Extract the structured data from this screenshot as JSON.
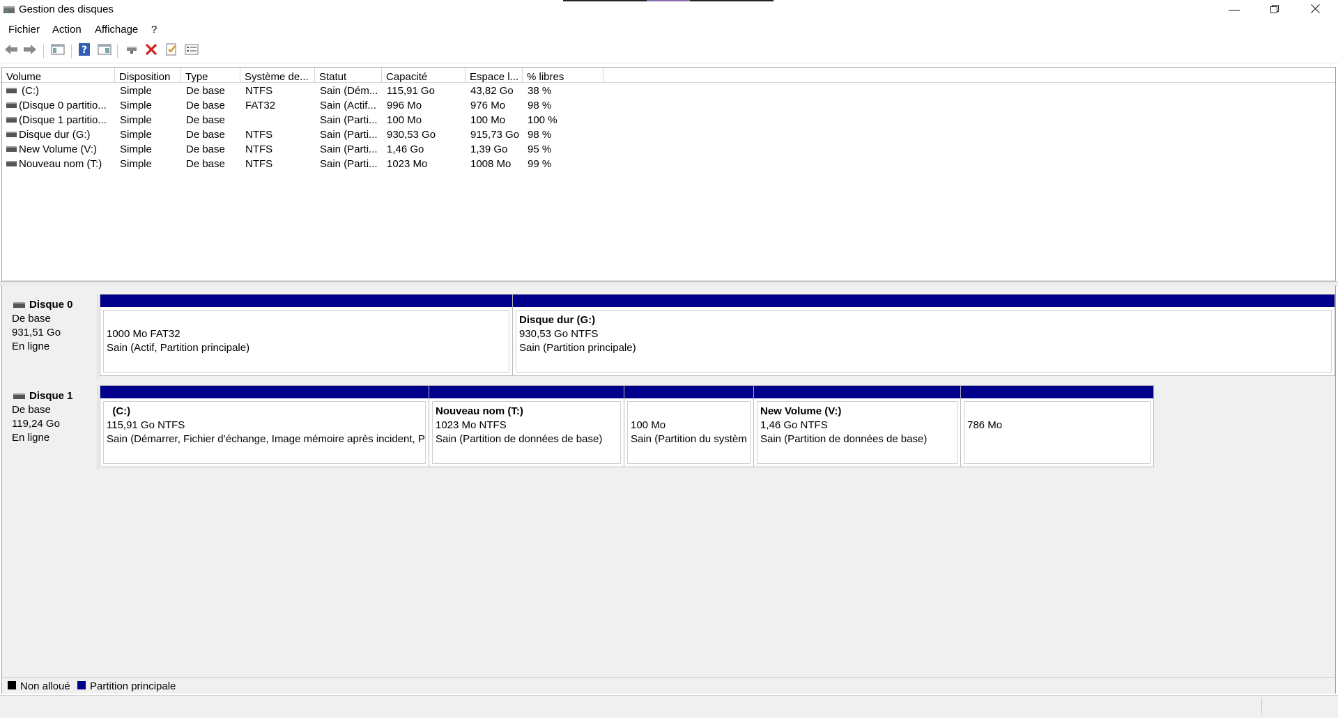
{
  "window": {
    "title": "Gestion des disques",
    "app_icon": "disk-management-icon",
    "controls": [
      "minimize-icon",
      "restore-icon",
      "close-icon"
    ]
  },
  "menu": {
    "items": [
      "Fichier",
      "Action",
      "Affichage",
      "?"
    ]
  },
  "toolbar": {
    "buttons": [
      "back-arrow-icon",
      "forward-arrow-icon",
      "console-tree-icon",
      "help-icon",
      "properties-panel-icon",
      "connect-icon",
      "delete-icon",
      "checklist-icon",
      "settings-list-icon"
    ]
  },
  "volume_list": {
    "columns": [
      "Volume",
      "Disposition",
      "Type",
      "Système de...",
      "Statut",
      "Capacité",
      "Espace l...",
      "% libres"
    ],
    "rows": [
      {
        "volume": "(C:)",
        "disposition": "Simple",
        "type": "De base",
        "fs": "NTFS",
        "status": "Sain (Dém...",
        "capacity": "115,91 Go",
        "free": "43,82 Go",
        "pct": "38 %"
      },
      {
        "volume": "(Disque 0 partitio...",
        "disposition": "Simple",
        "type": "De base",
        "fs": "FAT32",
        "status": "Sain (Actif...",
        "capacity": "996 Mo",
        "free": "976 Mo",
        "pct": "98 %"
      },
      {
        "volume": "(Disque 1 partitio...",
        "disposition": "Simple",
        "type": "De base",
        "fs": "",
        "status": "Sain (Parti...",
        "capacity": "100 Mo",
        "free": "100 Mo",
        "pct": "100 %"
      },
      {
        "volume": "Disque dur (G:)",
        "disposition": "Simple",
        "type": "De base",
        "fs": "NTFS",
        "status": "Sain (Parti...",
        "capacity": "930,53 Go",
        "free": "915,73 Go",
        "pct": "98 %"
      },
      {
        "volume": "New Volume (V:)",
        "disposition": "Simple",
        "type": "De base",
        "fs": "NTFS",
        "status": "Sain (Parti...",
        "capacity": "1,46 Go",
        "free": "1,39 Go",
        "pct": "95 %"
      },
      {
        "volume": "Nouveau nom (T:)",
        "disposition": "Simple",
        "type": "De base",
        "fs": "NTFS",
        "status": "Sain (Parti...",
        "capacity": "1023 Mo",
        "free": "1008 Mo",
        "pct": "99 %"
      }
    ]
  },
  "disks": [
    {
      "name": "Disque 0",
      "type": "De base",
      "size": "931,51 Go",
      "state": "En ligne",
      "partitions": [
        {
          "title": "",
          "size": "1000 Mo FAT32",
          "status": "Sain (Actif, Partition principale)",
          "color": "#00008b"
        },
        {
          "title": "Disque dur  (G:)",
          "size": "930,53 Go NTFS",
          "status": "Sain (Partition principale)",
          "color": "#00008b"
        }
      ]
    },
    {
      "name": "Disque 1",
      "type": "De base",
      "size": "119,24 Go",
      "state": "En ligne",
      "partitions": [
        {
          "title": "(C:)",
          "size": "115,91 Go NTFS",
          "status": "Sain (Démarrer, Fichier d’échange, Image mémoire après incident, P",
          "color": "#00008b"
        },
        {
          "title": "Nouveau nom  (T:)",
          "size": "1023 Mo NTFS",
          "status": "Sain (Partition de données de base)",
          "color": "#00008b"
        },
        {
          "title": "",
          "size": "100 Mo",
          "status": "Sain (Partition du systèm",
          "color": "#00008b"
        },
        {
          "title": "New Volume  (V:)",
          "size": "1,46 Go NTFS",
          "status": "Sain (Partition de données de base)",
          "color": "#00008b"
        },
        {
          "title": "",
          "size": "786 Mo",
          "status": "",
          "color": "#00008b"
        }
      ]
    }
  ],
  "legend": [
    {
      "label": "Non alloué",
      "color": "#000000"
    },
    {
      "label": "Partition principale",
      "color": "#00008b"
    }
  ]
}
